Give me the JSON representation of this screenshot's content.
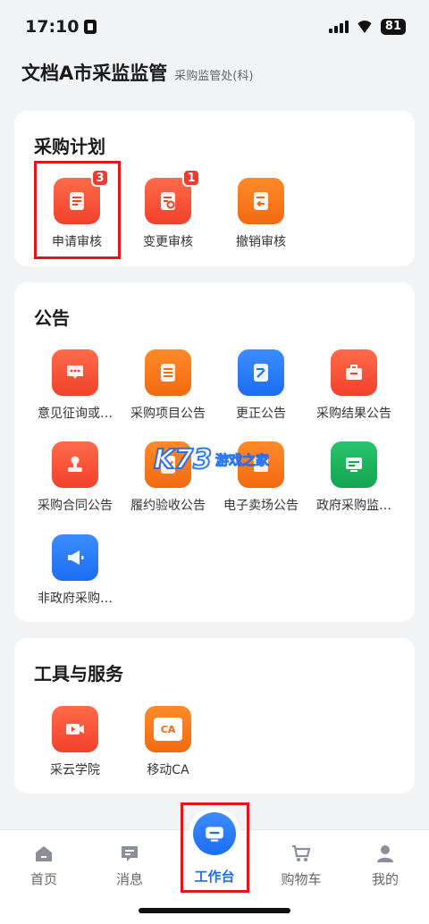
{
  "status_bar": {
    "time": "17:10",
    "battery": "81"
  },
  "header": {
    "title": "文档A市采监监管",
    "subtitle": "采购监管处(科)"
  },
  "procurement_plan": {
    "title": "采购计划",
    "items": [
      {
        "label": "申请审核",
        "badge": "3",
        "icon": "document-icon",
        "color": "#f2402b"
      },
      {
        "label": "变更审核",
        "badge": "1",
        "icon": "document-refresh-icon",
        "color": "#f2402b"
      },
      {
        "label": "撤销审核",
        "badge": "",
        "icon": "document-undo-icon",
        "color": "#f26a10"
      }
    ]
  },
  "announcements": {
    "title": "公告",
    "items": [
      {
        "label": "意见征询或…",
        "icon": "chat-icon",
        "color": "#f2402b"
      },
      {
        "label": "采购项目公告",
        "icon": "list-icon",
        "color": "#f26a10"
      },
      {
        "label": "更正公告",
        "icon": "edit-icon",
        "color": "#1c6df2"
      },
      {
        "label": "采购结果公告",
        "icon": "briefcase-icon",
        "color": "#f2402b"
      },
      {
        "label": "采购合同公告",
        "icon": "stamp-icon",
        "color": "#f2402b"
      },
      {
        "label": "履约验收公告",
        "icon": "check-document-icon",
        "color": "#f26a10"
      },
      {
        "label": "电子卖场公告",
        "icon": "store-icon",
        "color": "#f26a10"
      },
      {
        "label": "政府采购监…",
        "icon": "monitor-icon",
        "color": "#14a552"
      },
      {
        "label": "非政府采购…",
        "icon": "megaphone-icon",
        "color": "#1c6df2"
      }
    ]
  },
  "tools": {
    "title": "工具与服务",
    "items": [
      {
        "label": "采云学院",
        "icon": "video-icon",
        "color": "#f2402b"
      },
      {
        "label": "移动CA",
        "icon": "ca-certificate-icon",
        "color": "#f26a10",
        "glyph": "CA"
      }
    ]
  },
  "tabbar": {
    "home": "首页",
    "messages": "消息",
    "workbench": "工作台",
    "cart": "购物车",
    "mine": "我的"
  },
  "watermark": {
    "brand": "K73",
    "text": "游戏之家"
  },
  "colors": {
    "accent": "#1c6df2",
    "highlight": "#e3161a"
  }
}
